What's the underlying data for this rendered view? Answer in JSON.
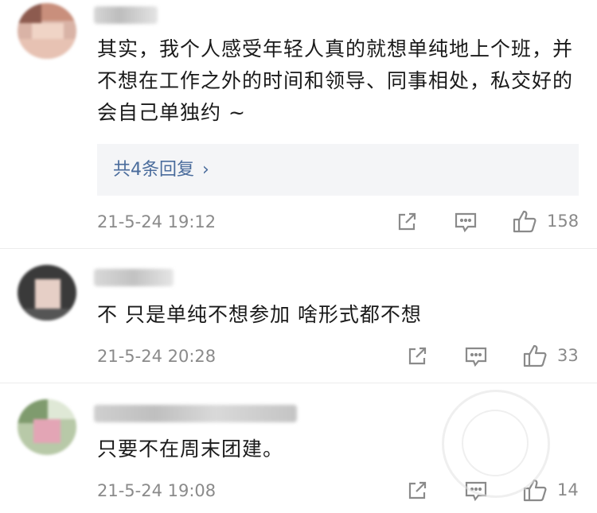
{
  "comments": [
    {
      "text": "其实，我个人感受年轻人真的就想单纯地上个班，并不想在工作之外的时间和领导、同事相处，私交好的会自己单独约 ~",
      "reply_summary": "共4条回复",
      "reply_chevron": "›",
      "time": "21-5-24 19:12",
      "likes": "158"
    },
    {
      "text": "不 只是单纯不想参加 啥形式都不想",
      "time": "21-5-24 20:28",
      "likes": "33"
    },
    {
      "text": "只要不在周末团建。",
      "time": "21-5-24 19:08",
      "likes": "14"
    }
  ],
  "icons": {
    "share": "share-icon",
    "comment": "comment-icon",
    "like": "thumbs-up-icon"
  },
  "colors": {
    "link": "#4a6c9c",
    "meta": "#8a8a8a",
    "reply_bg": "#f4f5f7"
  }
}
